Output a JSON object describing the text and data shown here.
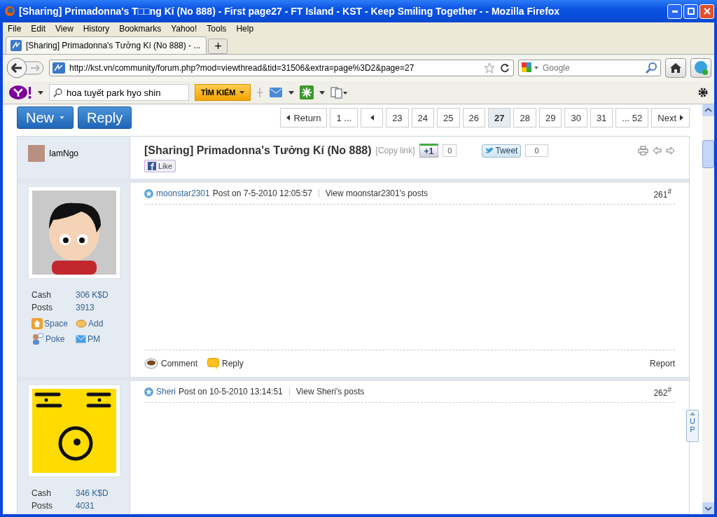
{
  "window": {
    "title": "[Sharing] Primadonna's T□□ng Kí (No 888) - First page27 - FT Island - KST - Keep Smiling Together - - Mozilla Firefox"
  },
  "menu": [
    "File",
    "Edit",
    "View",
    "History",
    "Bookmarks",
    "Yahoo!",
    "Tools",
    "Help"
  ],
  "tabs": [
    {
      "label": "[Sharing] Primadonna's Tưởng Kí (No 888) - ...",
      "selected": true
    }
  ],
  "new_tab": "+",
  "address_bar": {
    "url": "http://kst.vn/community/forum.php?mod=viewthread&tid=31506&extra=page%3D2&page=27"
  },
  "search_bar": {
    "placeholder": "Google"
  },
  "yahoo_toolbar": {
    "search_value": "hoa tuyết park hyo shin",
    "search_button": "TÌM KIẾM"
  },
  "thread_buttons": [
    {
      "label": "New",
      "kind": "dropdown"
    },
    {
      "label": "Reply",
      "kind": "plain"
    }
  ],
  "pagination": [
    {
      "label": "Return",
      "kind": "back",
      "selected": false
    },
    {
      "label": "1 ...",
      "kind": "page",
      "selected": false
    },
    {
      "kind": "arrow",
      "selected": false
    },
    {
      "label": "23",
      "kind": "page",
      "selected": false
    },
    {
      "label": "24",
      "kind": "page",
      "selected": false
    },
    {
      "label": "25",
      "kind": "page",
      "selected": false
    },
    {
      "label": "26",
      "kind": "page",
      "selected": false
    },
    {
      "label": "27",
      "kind": "page",
      "selected": true
    },
    {
      "label": "28",
      "kind": "page",
      "selected": false
    },
    {
      "label": "29",
      "kind": "page",
      "selected": false
    },
    {
      "label": "30",
      "kind": "page",
      "selected": false
    },
    {
      "label": "31",
      "kind": "page",
      "selected": false
    },
    {
      "label": "... 52",
      "kind": "page",
      "selected": false
    },
    {
      "label": "Next",
      "kind": "next",
      "selected": false
    }
  ],
  "thread_header": {
    "author": "IamNgo",
    "title": "[Sharing] Primadonna's Tưởng Kí (No 888)",
    "copy_link": "[Copy link]",
    "plus_one": "+1",
    "plus_one_count": "0",
    "tweet": "Tweet",
    "tweet_count": "0",
    "like": "Like"
  },
  "posts": [
    {
      "author": "moonstar2301",
      "meta": "Post on 7-5-2010 12:05:57",
      "view_posts": "View moonstar2301's posts",
      "floor": "261$^{#}$",
      "stats": [
        {
          "label": "Cash",
          "value": "306 K$D"
        },
        {
          "label": "Posts",
          "value": "3913"
        }
      ],
      "links": [
        "Space",
        "Add",
        "Poke",
        "PM"
      ],
      "actions": [
        "Comment",
        "Reply"
      ],
      "report": "Report"
    },
    {
      "author": "Sheri",
      "meta": "Post on 10-5-2010 13:14:51",
      "view_posts": "View Sheri's posts",
      "floor": "262$^{#}$",
      "stats": [
        {
          "label": "Cash",
          "value": "346 K$D"
        },
        {
          "label": "Posts",
          "value": "4031"
        }
      ]
    }
  ],
  "side_button": "UP"
}
